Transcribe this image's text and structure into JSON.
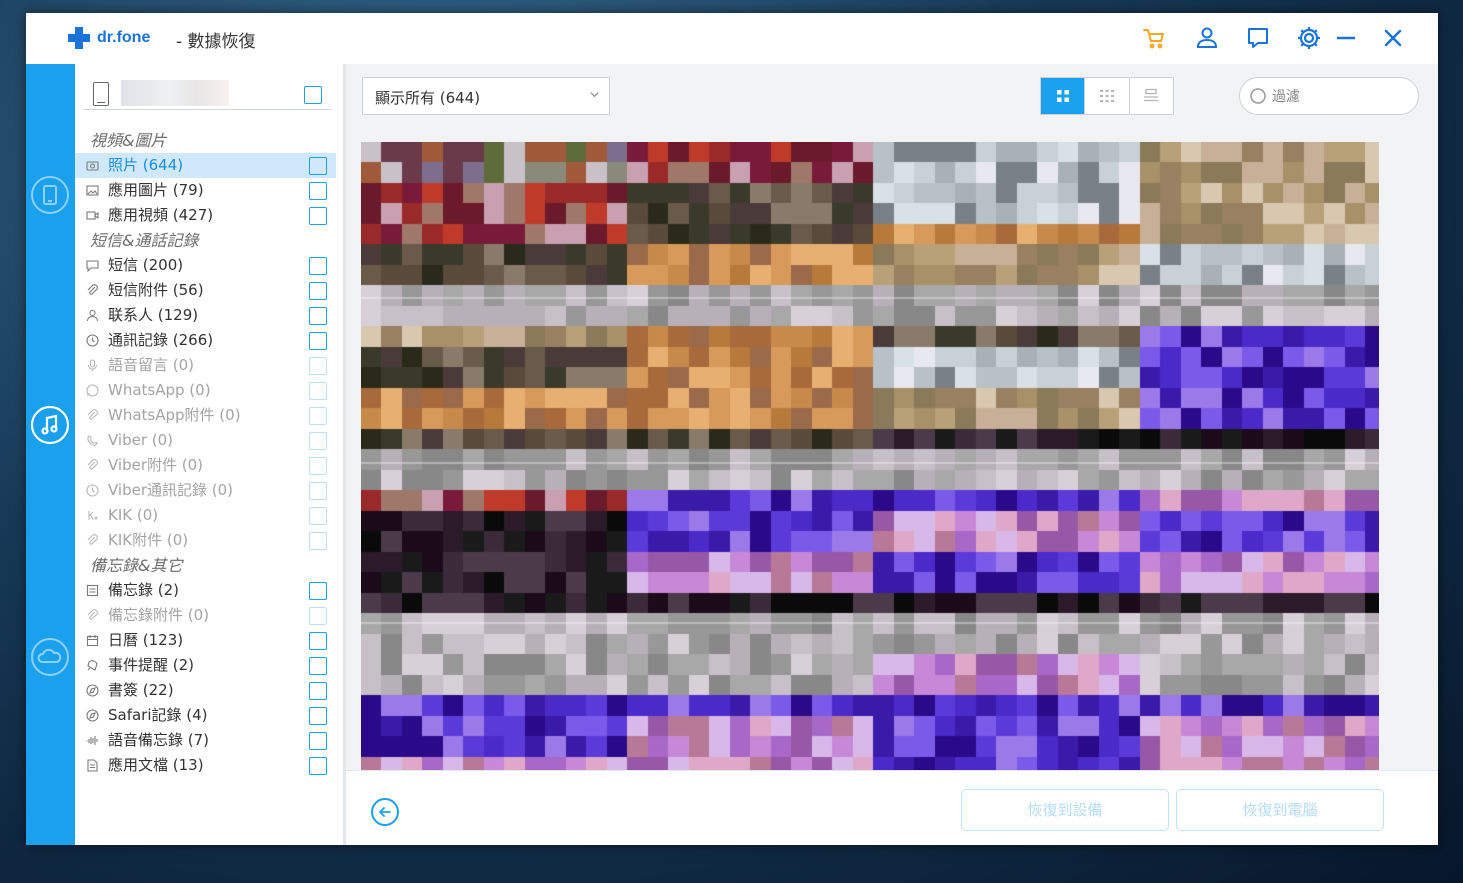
{
  "app": {
    "brand": "dr.fone",
    "title": "- 數據恢復"
  },
  "device": {
    "name": ""
  },
  "categories": [
    {
      "title": "視頻&圖片",
      "items": [
        {
          "icon": "photo-icon",
          "label": "照片 (644)",
          "state": "selected"
        },
        {
          "icon": "image-icon",
          "label": "應用圖片 (79)",
          "state": "normal"
        },
        {
          "icon": "video-icon",
          "label": "應用視頻 (427)",
          "state": "normal"
        }
      ]
    },
    {
      "title": "短信&通話記錄",
      "items": [
        {
          "icon": "message-icon",
          "label": "短信 (200)",
          "state": "normal"
        },
        {
          "icon": "attachment-icon",
          "label": "短信附件 (56)",
          "state": "normal"
        },
        {
          "icon": "contact-icon",
          "label": "联系人 (129)",
          "state": "normal"
        },
        {
          "icon": "clock-icon",
          "label": "通訊記錄 (266)",
          "state": "normal"
        },
        {
          "icon": "mic-icon",
          "label": "語音留言 (0)",
          "state": "disabled"
        },
        {
          "icon": "whatsapp-icon",
          "label": "WhatsApp (0)",
          "state": "disabled"
        },
        {
          "icon": "attachment-icon",
          "label": "WhatsApp附件 (0)",
          "state": "disabled"
        },
        {
          "icon": "viber-icon",
          "label": "Viber (0)",
          "state": "disabled"
        },
        {
          "icon": "attachment-icon",
          "label": "Viber附件 (0)",
          "state": "disabled"
        },
        {
          "icon": "clock-icon",
          "label": "Viber通訊記錄 (0)",
          "state": "disabled"
        },
        {
          "icon": "kik-icon",
          "label": "KIK (0)",
          "state": "disabled"
        },
        {
          "icon": "attachment-icon",
          "label": "KIK附件 (0)",
          "state": "disabled"
        }
      ]
    },
    {
      "title": "備忘錄&其它",
      "items": [
        {
          "icon": "note-icon",
          "label": "備忘錄 (2)",
          "state": "normal"
        },
        {
          "icon": "attachment-icon",
          "label": "備忘錄附件 (0)",
          "state": "disabled"
        },
        {
          "icon": "calendar-icon",
          "label": "日曆 (123)",
          "state": "normal"
        },
        {
          "icon": "reminder-icon",
          "label": "事件提醒 (2)",
          "state": "normal"
        },
        {
          "icon": "bookmark-icon",
          "label": "書簽 (22)",
          "state": "normal"
        },
        {
          "icon": "safari-icon",
          "label": "Safari記錄 (4)",
          "state": "normal"
        },
        {
          "icon": "voice-memo-icon",
          "label": "語音備忘錄 (7)",
          "state": "normal"
        },
        {
          "icon": "document-icon",
          "label": "應用文檔 (13)",
          "state": "normal"
        }
      ]
    }
  ],
  "toolbar": {
    "filter": {
      "selected": "顯示所有 (644)"
    },
    "view_modes": [
      "grid-large",
      "grid-small",
      "list"
    ],
    "active_view": "grid-large",
    "search": {
      "placeholder": "過濾",
      "value": ""
    }
  },
  "actions": {
    "restore_device": "恢復到設備",
    "restore_computer": "恢復到電腦"
  },
  "colors": {
    "accent": "#1aa0ec",
    "cart": "#f5a623",
    "disabled_text": "#b5dcf3"
  }
}
